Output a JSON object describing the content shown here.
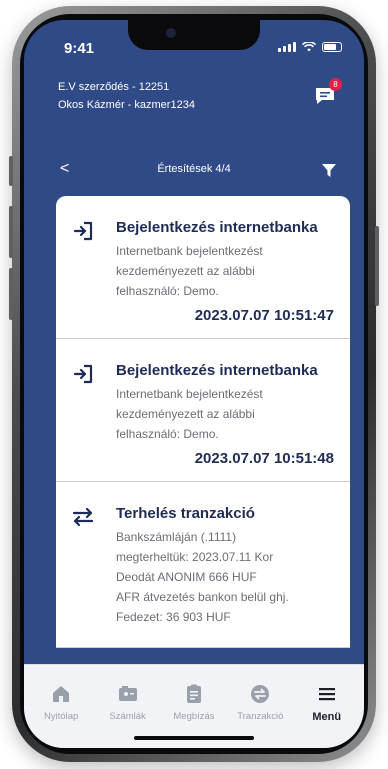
{
  "status_bar": {
    "time": "9:41"
  },
  "header": {
    "contract_line": "E.V szerződés - 12251",
    "user_line": "Okos Kázmér - kazmer1234",
    "chat_badge": "8"
  },
  "nav": {
    "title": "Értesítések 4/4",
    "back_symbol": "<"
  },
  "notifications": [
    {
      "icon": "login-arrow-icon",
      "title": "Bejelentkezés internetbanka",
      "lines": [
        "Internetbank bejelentkezést",
        "kezdeményezett az alábbi",
        "felhasználó: Demo."
      ],
      "time": "2023.07.07 10:51:47"
    },
    {
      "icon": "login-arrow-icon",
      "title": "Bejelentkezés internetbanka",
      "lines": [
        "Internetbank bejelentkezést",
        "kezdeményezett az alábbi",
        "felhasználó: Demo."
      ],
      "time": "2023.07.07 10:51:48"
    },
    {
      "icon": "transfer-arrows-icon",
      "title": "Terhelés tranzakció",
      "lines": [
        "Bankszámláján (.1111)",
        "megterheltük: 2023.07.11 Kor",
        "Deodát ANONIM 666 HUF",
        "AFR átvezetés bankon belül ghj.",
        "Fedezet: 36 903 HUF"
      ],
      "time": ""
    }
  ],
  "tabbar": {
    "tabs": [
      {
        "label": "Nyitólap",
        "icon": "home-icon",
        "active": false
      },
      {
        "label": "Számlák",
        "icon": "account-card-icon",
        "active": false
      },
      {
        "label": "Megbízás",
        "icon": "clipboard-icon",
        "active": false
      },
      {
        "label": "Tranzakció",
        "icon": "transfer-circle-icon",
        "active": false
      },
      {
        "label": "Menü",
        "icon": "hamburger-menu-icon",
        "active": true
      }
    ]
  },
  "colors": {
    "header_bg": "#2f4a86",
    "badge": "#e02048",
    "title_navy": "#1f2c55"
  }
}
